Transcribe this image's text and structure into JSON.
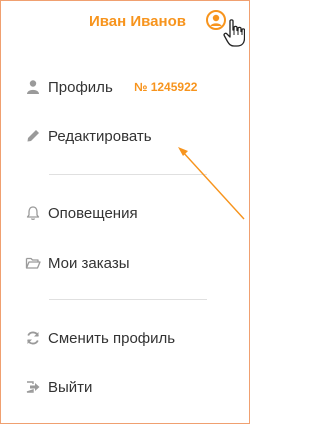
{
  "header": {
    "user_name": "Иван Иванов",
    "accent_color": "#f7941d"
  },
  "menu": {
    "profile": {
      "label": "Профиль",
      "id_badge": "№ 1245922",
      "icon": "user-icon"
    },
    "edit": {
      "label": "Редактировать",
      "icon": "pencil-icon"
    },
    "notifications": {
      "label": "Оповещения",
      "icon": "bell-icon"
    },
    "orders": {
      "label": "Мои заказы",
      "icon": "folder-icon"
    },
    "switch_profile": {
      "label": "Сменить профиль",
      "icon": "refresh-icon"
    },
    "logout": {
      "label": "Выйти",
      "icon": "logout-icon"
    }
  }
}
